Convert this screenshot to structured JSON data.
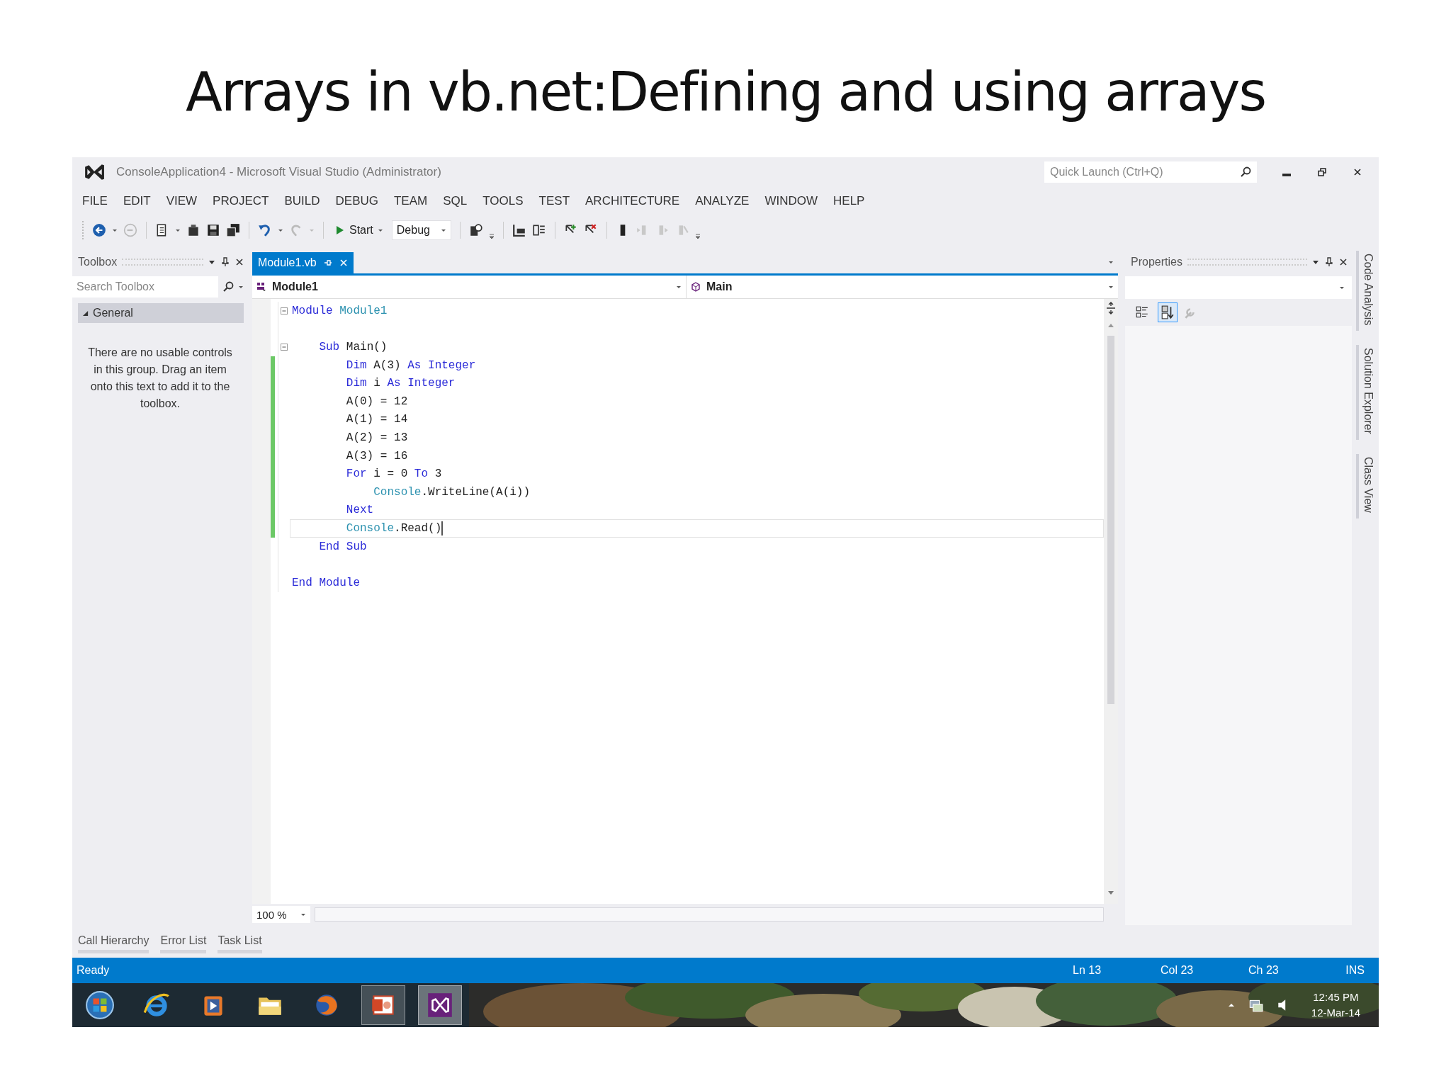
{
  "slide": {
    "title": "Arrays in vb.net:Defining and using arrays"
  },
  "window": {
    "title": "ConsoleApplication4 - Microsoft Visual Studio (Administrator)",
    "quick_launch": {
      "placeholder": "Quick Launch (Ctrl+Q)"
    }
  },
  "menu": [
    "FILE",
    "EDIT",
    "VIEW",
    "PROJECT",
    "BUILD",
    "DEBUG",
    "TEAM",
    "SQL",
    "TOOLS",
    "TEST",
    "ARCHITECTURE",
    "ANALYZE",
    "WINDOW",
    "HELP"
  ],
  "toolbar": {
    "start_label": "Start",
    "configuration": "Debug"
  },
  "toolbox": {
    "title": "Toolbox",
    "search": {
      "placeholder": "Search Toolbox"
    },
    "group": {
      "label": "General",
      "expanded": true
    },
    "empty_message": "There are no usable controls in this group. Drag an item onto this text to add it to the toolbox."
  },
  "editor": {
    "tabs": [
      {
        "label": "Module1.vb",
        "selected": true
      }
    ],
    "type_selector": "Module1",
    "member_selector": "Main",
    "zoom": "100 %",
    "lines": [
      {
        "fold": true,
        "changed": false,
        "current": false,
        "segments": [
          {
            "text": "Module",
            "kind": "keyword"
          },
          {
            "text": " Module1",
            "kind": "type"
          }
        ]
      },
      {
        "fold": false,
        "changed": false,
        "current": false
      },
      {
        "fold": true,
        "changed": false,
        "current": false,
        "segments": [
          {
            "text": "    Sub",
            "kind": "keyword"
          },
          {
            "text": " Main()",
            "kind": "plain"
          }
        ]
      },
      {
        "fold": false,
        "changed": true,
        "current": false,
        "segments": [
          {
            "text": "        Dim",
            "kind": "keyword"
          },
          {
            "text": " A(3) ",
            "kind": "plain"
          },
          {
            "text": "As",
            "kind": "keyword"
          },
          {
            "text": " Integer",
            "kind": "keyword"
          }
        ]
      },
      {
        "fold": false,
        "changed": true,
        "current": false,
        "segments": [
          {
            "text": "        Dim",
            "kind": "keyword"
          },
          {
            "text": " i ",
            "kind": "plain"
          },
          {
            "text": "As",
            "kind": "keyword"
          },
          {
            "text": " Integer",
            "kind": "keyword"
          }
        ]
      },
      {
        "fold": false,
        "changed": true,
        "current": false,
        "segments": [
          {
            "text": "        A(0) = 12",
            "kind": "plain"
          }
        ]
      },
      {
        "fold": false,
        "changed": true,
        "current": false,
        "segments": [
          {
            "text": "        A(1) = 14",
            "kind": "plain"
          }
        ]
      },
      {
        "fold": false,
        "changed": true,
        "current": false,
        "segments": [
          {
            "text": "        A(2) = 13",
            "kind": "plain"
          }
        ]
      },
      {
        "fold": false,
        "changed": true,
        "current": false,
        "segments": [
          {
            "text": "        A(3) = 16",
            "kind": "plain"
          }
        ]
      },
      {
        "fold": false,
        "changed": true,
        "current": false,
        "segments": [
          {
            "text": "        For",
            "kind": "keyword"
          },
          {
            "text": " i = 0 ",
            "kind": "plain"
          },
          {
            "text": "To",
            "kind": "keyword"
          },
          {
            "text": " 3",
            "kind": "plain"
          }
        ]
      },
      {
        "fold": false,
        "changed": true,
        "current": false,
        "segments": [
          {
            "text": "            Console",
            "kind": "type"
          },
          {
            "text": ".WriteLine(A(i))",
            "kind": "plain"
          }
        ]
      },
      {
        "fold": false,
        "changed": true,
        "current": false,
        "segments": [
          {
            "text": "        Next",
            "kind": "keyword"
          }
        ]
      },
      {
        "fold": false,
        "changed": true,
        "current": true,
        "segments": [
          {
            "text": "        Console",
            "kind": "type"
          },
          {
            "text": ".Read()",
            "kind": "plain"
          }
        ]
      },
      {
        "fold": false,
        "changed": false,
        "current": false,
        "segments": [
          {
            "text": "    End",
            "kind": "keyword"
          },
          {
            "text": " Sub",
            "kind": "keyword"
          }
        ]
      },
      {
        "fold": false,
        "changed": false,
        "current": false
      },
      {
        "fold": false,
        "changed": false,
        "current": false,
        "segments": [
          {
            "text": "End",
            "kind": "keyword"
          },
          {
            "text": " Module",
            "kind": "keyword"
          }
        ]
      }
    ]
  },
  "properties": {
    "title": "Properties",
    "view_buttons": [
      {
        "kind": "categorized",
        "selected": false
      },
      {
        "kind": "alphabetical",
        "selected": true
      }
    ]
  },
  "side_tabs": [
    "Code Analysis",
    "Solution Explorer",
    "Class View"
  ],
  "bottom_tabs": [
    "Call Hierarchy",
    "Error List",
    "Task List"
  ],
  "status_bar": {
    "message": "Ready",
    "line": "Ln 13",
    "column": "Col 23",
    "char": "Ch 23",
    "mode": "INS"
  },
  "taskbar": {
    "time": "12:45 PM",
    "date": "12-Mar-14"
  }
}
